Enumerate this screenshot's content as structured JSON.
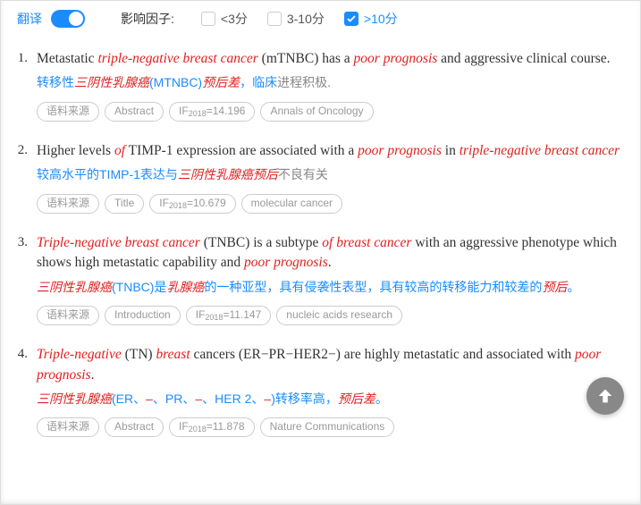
{
  "topbar": {
    "translate_label": "翻译",
    "toggle_on": true,
    "factor_label": "影响因子:",
    "filters": [
      {
        "label": "<3分",
        "checked": false
      },
      {
        "label": "3-10分",
        "checked": false
      },
      {
        "label": ">10分",
        "checked": true
      }
    ]
  },
  "source_tag_label": "语料来源",
  "items": [
    {
      "num": "1.",
      "english_parts": [
        {
          "t": "Metastatic ",
          "hl": false
        },
        {
          "t": "triple-negative breast cancer",
          "hl": true
        },
        {
          "t": " (mTNBC) has a ",
          "hl": false
        },
        {
          "t": "poor prognosis",
          "hl": true
        },
        {
          "t": " and aggressive clinical course.",
          "hl": false
        }
      ],
      "chinese_parts": [
        {
          "t": "转移性",
          "c": "blue"
        },
        {
          "t": "三阴性乳腺癌",
          "c": "red"
        },
        {
          "t": "(MTNBC)",
          "c": "blue"
        },
        {
          "t": "预后差",
          "c": "red"
        },
        {
          "t": "，临床",
          "c": "blue"
        },
        {
          "t": "进程积极",
          "c": "grey"
        },
        {
          "t": ".",
          "c": "blue"
        }
      ],
      "tags": [
        "Abstract",
        {
          "if_year": "2018",
          "if_val": "14.196"
        },
        "Annals of Oncology"
      ]
    },
    {
      "num": "2.",
      "english_parts": [
        {
          "t": "Higher levels ",
          "hl": false
        },
        {
          "t": "of",
          "hl": true
        },
        {
          "t": " TIMP-1 expression are associated with a ",
          "hl": false
        },
        {
          "t": "poor prognosis",
          "hl": true
        },
        {
          "t": " in ",
          "hl": false
        },
        {
          "t": "triple-negative breast cancer",
          "hl": true
        }
      ],
      "chinese_parts": [
        {
          "t": "较高水平的TIMP-1表达与",
          "c": "blue"
        },
        {
          "t": "三阴性乳腺癌预后",
          "c": "red"
        },
        {
          "t": "不良有关",
          "c": "grey"
        }
      ],
      "tags": [
        "Title",
        {
          "if_year": "2018",
          "if_val": "10.679"
        },
        "molecular cancer"
      ]
    },
    {
      "num": "3.",
      "english_parts": [
        {
          "t": "Triple-negative breast cancer",
          "hl": true
        },
        {
          "t": " (TNBC) is a subtype ",
          "hl": false
        },
        {
          "t": "of breast cancer",
          "hl": true
        },
        {
          "t": " with an aggressive phenotype which shows high metastatic capability and ",
          "hl": false
        },
        {
          "t": "poor prognosis",
          "hl": true
        },
        {
          "t": ".",
          "hl": false
        }
      ],
      "chinese_parts": [
        {
          "t": "三阴性乳腺癌",
          "c": "red"
        },
        {
          "t": "(TNBC)是",
          "c": "blue"
        },
        {
          "t": "乳腺癌",
          "c": "red"
        },
        {
          "t": "的一种亚型，具有侵袭性表型，具有较高的转移能力和较差的",
          "c": "blue"
        },
        {
          "t": "预后",
          "c": "red"
        },
        {
          "t": "。",
          "c": "blue"
        }
      ],
      "tags": [
        "Introduction",
        {
          "if_year": "2018",
          "if_val": "11.147"
        },
        "nucleic acids research"
      ]
    },
    {
      "num": "4.",
      "english_parts": [
        {
          "t": "Triple-negative",
          "hl": true
        },
        {
          "t": " (TN) ",
          "hl": false
        },
        {
          "t": "breast",
          "hl": true
        },
        {
          "t": " cancers (ER−PR−HER2−) are highly metastatic and associated with ",
          "hl": false
        },
        {
          "t": "poor prognosis",
          "hl": true
        },
        {
          "t": ".",
          "hl": false
        }
      ],
      "chinese_parts": [
        {
          "t": "三阴性乳腺癌",
          "c": "red"
        },
        {
          "t": "(ER、",
          "c": "blue"
        },
        {
          "t": "–",
          "c": "red"
        },
        {
          "t": "、PR、",
          "c": "blue"
        },
        {
          "t": "–",
          "c": "red"
        },
        {
          "t": "、HER 2、",
          "c": "blue"
        },
        {
          "t": "–",
          "c": "red"
        },
        {
          "t": ")转移率高，",
          "c": "blue"
        },
        {
          "t": "预后差",
          "c": "red"
        },
        {
          "t": "。",
          "c": "blue"
        }
      ],
      "tags": [
        "Abstract",
        {
          "if_year": "2018",
          "if_val": "11.878"
        },
        "Nature Communications"
      ]
    }
  ]
}
